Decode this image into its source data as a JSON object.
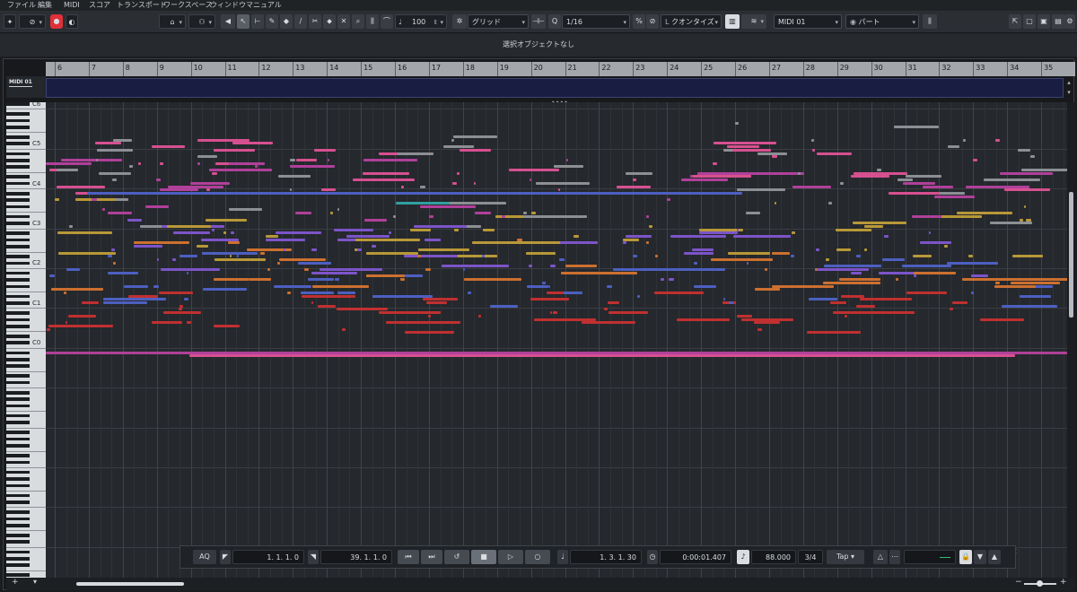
{
  "menu": [
    "ファイル",
    "編集",
    "MIDI",
    "スコア",
    "トランスポート",
    "ワークスペース",
    "ウィンドウ",
    "マニュアル"
  ],
  "toolbar": {
    "velocity": "100",
    "grid_type": "グリッド",
    "quantize_value": "1/16",
    "quantize_label": "クオンタイズ",
    "track": "MIDI 01",
    "part": "パート"
  },
  "status": {
    "text": "選択オブジェクトなし"
  },
  "ruler": {
    "bars": [
      "6",
      "7",
      "8",
      "9",
      "10",
      "11",
      "12",
      "13",
      "14",
      "15",
      "16",
      "17",
      "18",
      "19",
      "20",
      "21",
      "22",
      "23",
      "24",
      "25",
      "26",
      "27",
      "28",
      "29",
      "30",
      "31",
      "32",
      "33",
      "34",
      "35"
    ]
  },
  "track": {
    "name": "MIDI 01"
  },
  "piano": {
    "labels": [
      "C6",
      "C5",
      "C4",
      "C3",
      "C2",
      "C1",
      "C0"
    ]
  },
  "transport": {
    "aq": "AQ",
    "left_locator": "1. 1. 1.   0",
    "right_locator": "39. 1. 1.   0",
    "position": "1. 3. 1. 30",
    "time": "0:00:01.407",
    "tempo": "88.000",
    "signature": "3/4",
    "tap": "Tap"
  },
  "colors": {
    "purple": "#7c54c8",
    "blue": "#4d5fc0",
    "pink": "#d65090",
    "magenta": "#b0409a",
    "gold": "#b89838",
    "orange": "#cc7030",
    "red": "#c03030",
    "gray": "#8c9094",
    "teal": "#30a0a0",
    "record": "#e0303a"
  }
}
